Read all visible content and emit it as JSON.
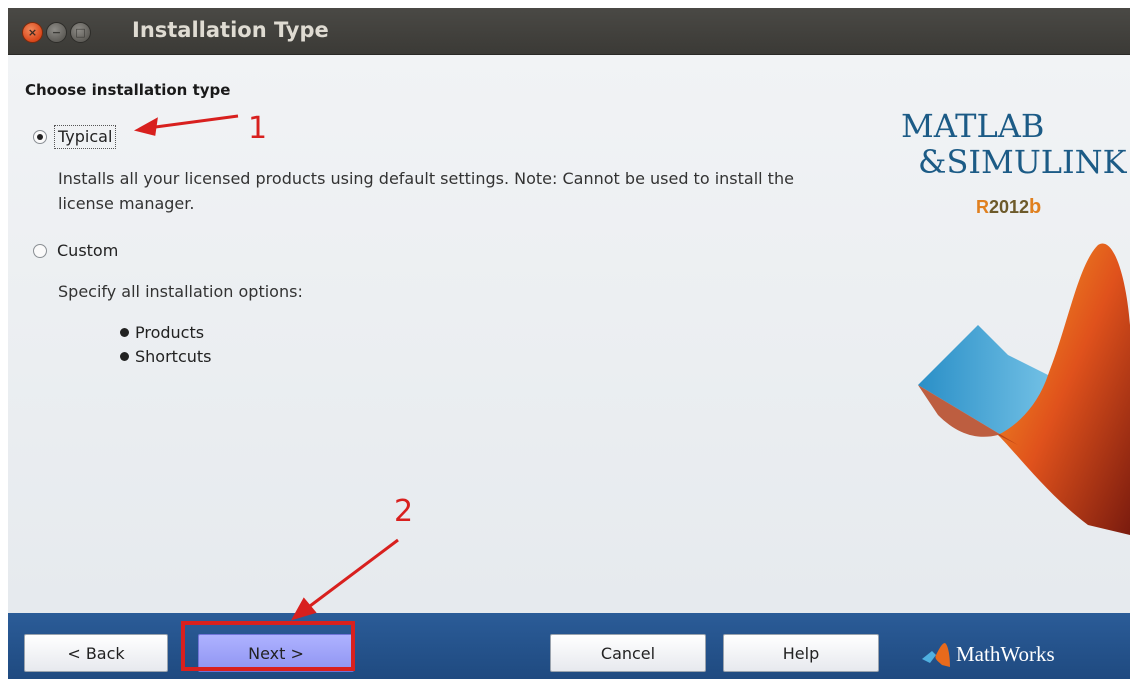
{
  "window": {
    "title": "Installation Type",
    "controls": [
      "close-icon",
      "minimize-icon",
      "maximize-icon"
    ]
  },
  "main": {
    "heading": "Choose installation type",
    "options": [
      {
        "label": "Typical",
        "selected": true,
        "description": "Installs all your licensed products using default settings. Note: Cannot be used to install the license manager."
      },
      {
        "label": "Custom",
        "selected": false,
        "description": "Specify all installation options:",
        "items": [
          "Products",
          "Shortcuts"
        ]
      }
    ]
  },
  "branding": {
    "product_line1": "MATLAB",
    "product_line2": "&SIMULINK",
    "release_r": "R",
    "release_year": "2012",
    "release_b": "b",
    "vendor": "MathWorks",
    "colors": {
      "logo_blue": "#1c5b86",
      "release_orange": "#e0801f"
    }
  },
  "annotations": {
    "marker1": "1",
    "marker2": "2",
    "color": "#d8201e"
  },
  "footer": {
    "back_label": "< Back",
    "next_label": "Next >",
    "cancel_label": "Cancel",
    "help_label": "Help"
  }
}
